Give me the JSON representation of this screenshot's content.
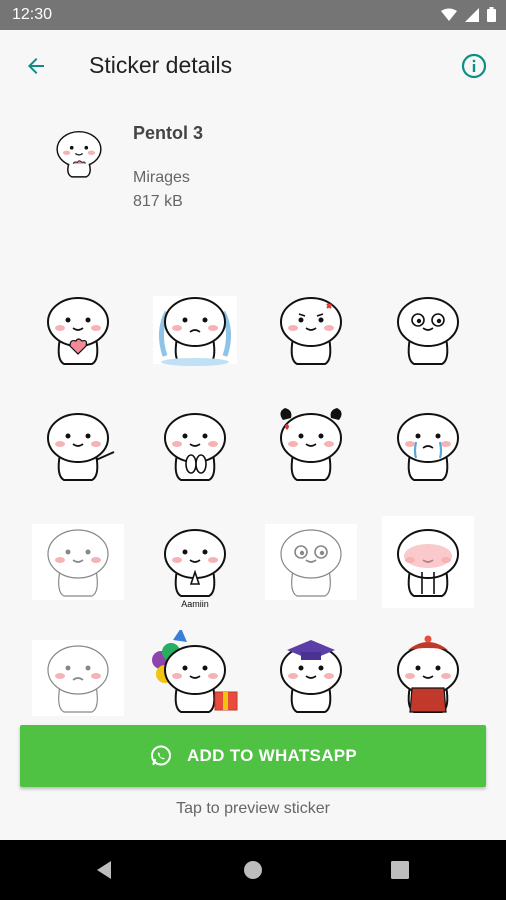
{
  "status_bar": {
    "time": "12:30",
    "icons": [
      "wifi-icon",
      "signal-icon",
      "battery-icon"
    ]
  },
  "app_bar": {
    "title": "Sticker details",
    "back_icon": "arrow-back-icon",
    "info_icon": "info-icon"
  },
  "pack": {
    "name": "Pentol 3",
    "publisher": "Mirages",
    "size": "817 kB"
  },
  "stickers": [
    {
      "kind": "heart-hug"
    },
    {
      "kind": "crying-fountain"
    },
    {
      "kind": "angry-vein"
    },
    {
      "kind": "shocked"
    },
    {
      "kind": "pointing"
    },
    {
      "kind": "clapping"
    },
    {
      "kind": "pigtails-heart"
    },
    {
      "kind": "crying-tears"
    },
    {
      "kind": "sketch-sitting"
    },
    {
      "kind": "praying",
      "caption": "Aamiin"
    },
    {
      "kind": "sketch-wide-eyes"
    },
    {
      "kind": "blushing-big"
    },
    {
      "kind": "sketch-sad"
    },
    {
      "kind": "birthday-balloons"
    },
    {
      "kind": "graduation"
    },
    {
      "kind": "chinese-new-year"
    }
  ],
  "actions": {
    "add_label": "ADD TO WHATSAPP",
    "add_icon": "whatsapp-icon",
    "preview_hint": "Tap to preview sticker"
  },
  "nav": {
    "back": "nav-back-icon",
    "home": "nav-home-icon",
    "recents": "nav-recents-icon"
  },
  "colors": {
    "accent": "#0e8e84",
    "button": "#4fc143",
    "status_bar": "#757575",
    "nav_bar": "#000000"
  }
}
